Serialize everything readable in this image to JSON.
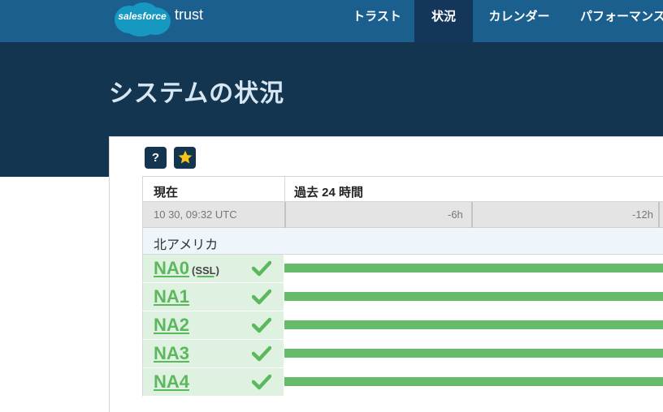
{
  "logo": {
    "cloud_text": "salesforce",
    "word": "trust"
  },
  "nav": {
    "items": [
      {
        "label": "トラスト",
        "active": false
      },
      {
        "label": "状況",
        "active": true
      },
      {
        "label": "カレンダー",
        "active": false
      },
      {
        "label": "パフォーマンス",
        "active": false
      }
    ]
  },
  "page": {
    "title": "システムの状況"
  },
  "toolbar": {
    "help_label": "?"
  },
  "table": {
    "now_header": "現在",
    "past_header": "過去 24 時間",
    "timestamp": "10 30, 09:32 UTC",
    "ticks": [
      "-6h",
      "-12h"
    ],
    "region": "北アメリカ",
    "instances": [
      {
        "name": "NA0",
        "note": "(SSL)",
        "status": "ok"
      },
      {
        "name": "NA1",
        "note": "",
        "status": "ok"
      },
      {
        "name": "NA2",
        "note": "",
        "status": "ok"
      },
      {
        "name": "NA3",
        "note": "",
        "status": "ok"
      },
      {
        "name": "NA4",
        "note": "",
        "status": "ok"
      }
    ]
  },
  "colors": {
    "nav_bg": "#1b5f8f",
    "band_bg": "#14354f",
    "status_green": "#65bb6a",
    "link_green": "#5cb85c"
  }
}
